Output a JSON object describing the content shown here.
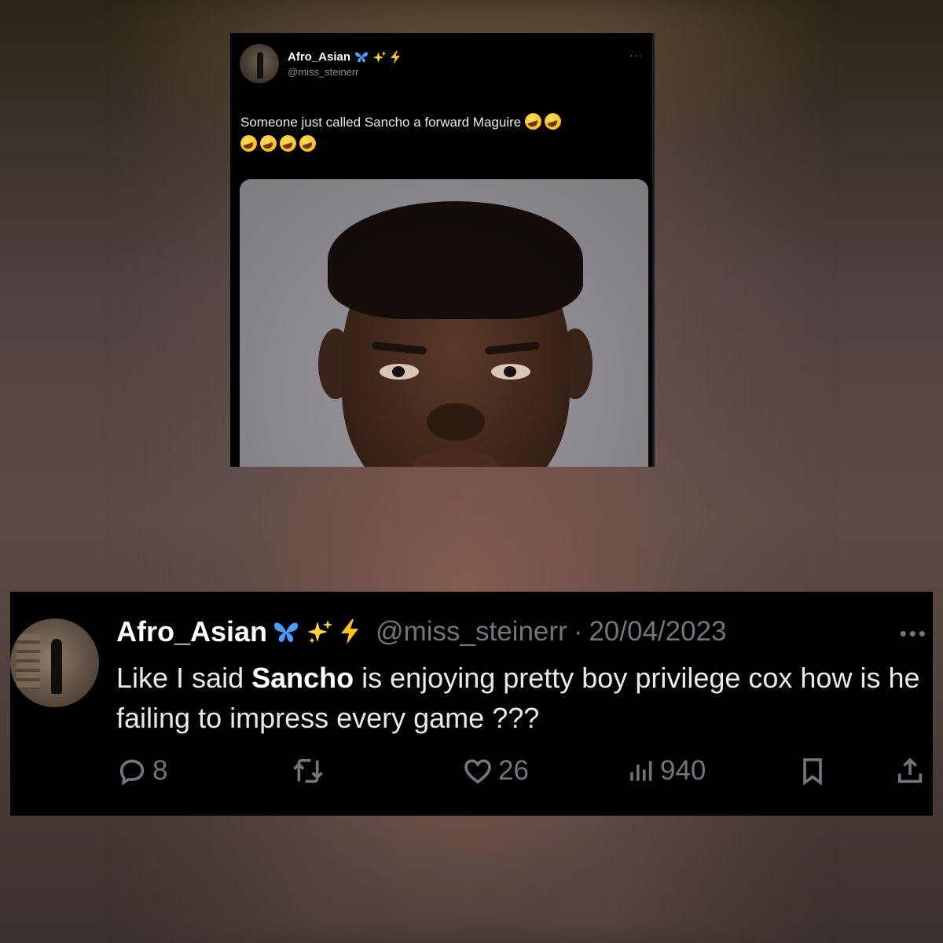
{
  "top_tweet": {
    "author_name": "Afro_Asian",
    "handle": "@miss_steinerr",
    "more": "···",
    "text": "Someone just called Sancho a forward Maguire",
    "emoji_line1_count": 2,
    "emoji_line2_count": 4,
    "emoji_icon": "rolling-laughing-face-icon"
  },
  "bottom_tweet": {
    "author_name": "Afro_Asian",
    "handle": "@miss_steinerr",
    "separator": "·",
    "date": "20/04/2023",
    "more": "•••",
    "text_before": "Like I said ",
    "text_bold": "Sancho",
    "text_after": " is enjoying pretty boy privilege cox how is he failing to impress every game ???",
    "actions": {
      "replies": "8",
      "reposts": "",
      "likes": "26",
      "views": "940"
    }
  },
  "badges": [
    "butterfly-icon",
    "sparkles-icon",
    "bolt-icon"
  ],
  "colors": {
    "card_bg": "#000000",
    "text_primary": "#e7e9ea",
    "text_secondary": "#71767b",
    "butterfly": "#4a9dff",
    "sparkles": "#ffd43b",
    "bolt": "#ffc21a"
  }
}
